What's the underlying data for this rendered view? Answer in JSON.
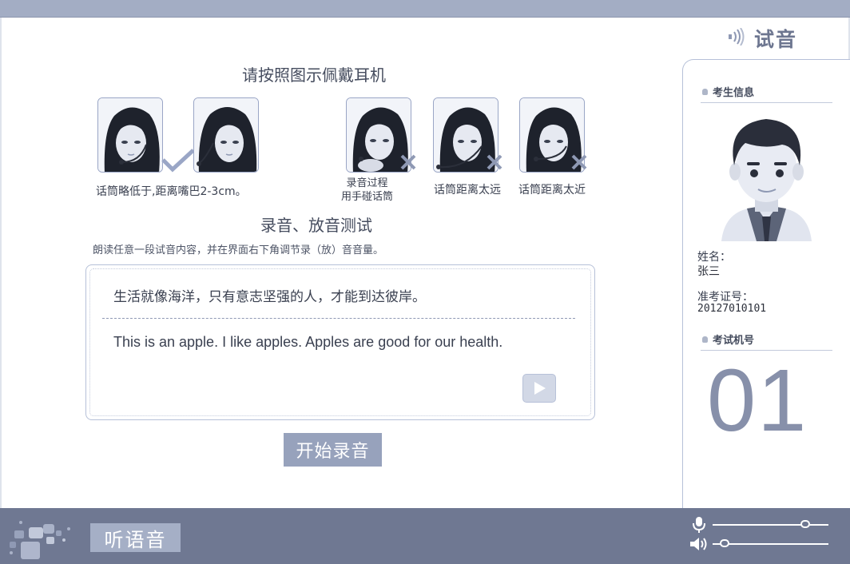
{
  "header": {
    "title": "试音"
  },
  "instructions": {
    "headline": "请按照图示佩戴耳机",
    "images": [
      {
        "status": "correct"
      },
      {
        "status": "correct"
      },
      {
        "status": "wrong"
      },
      {
        "status": "wrong"
      },
      {
        "status": "wrong"
      }
    ],
    "caption_correct": "话筒略低于,距离嘴巴2-3cm。",
    "caption_wrong_1_line1": "录音过程",
    "caption_wrong_1_line2": "用手碰话筒",
    "caption_wrong_2": "话筒距离太远",
    "caption_wrong_3": "话筒距离太近"
  },
  "test": {
    "title": "录音、放音测试",
    "instruction": "朗读任意一段试音内容，并在界面右下角调节录（放）音音量。",
    "chinese_text": "生活就像海洋，只有意志坚强的人，才能到达彼岸。",
    "english_text": "This is an apple. I like apples. Apples are good for our health.",
    "start_button": "开始录音"
  },
  "sidebar": {
    "candidate_section": "考生信息",
    "name_label": "姓名：",
    "name_value": "张三",
    "id_label": "准考证号：",
    "id_value": "20127010101",
    "machine_section": "考试机号",
    "machine_number": "01"
  },
  "footer": {
    "listen_button": "听语音",
    "mic_volume": 0.8,
    "speaker_volume": 0.1
  },
  "colors": {
    "accent": "#97a2bc",
    "bar": "#6f7892",
    "top": "#a3adc4"
  }
}
